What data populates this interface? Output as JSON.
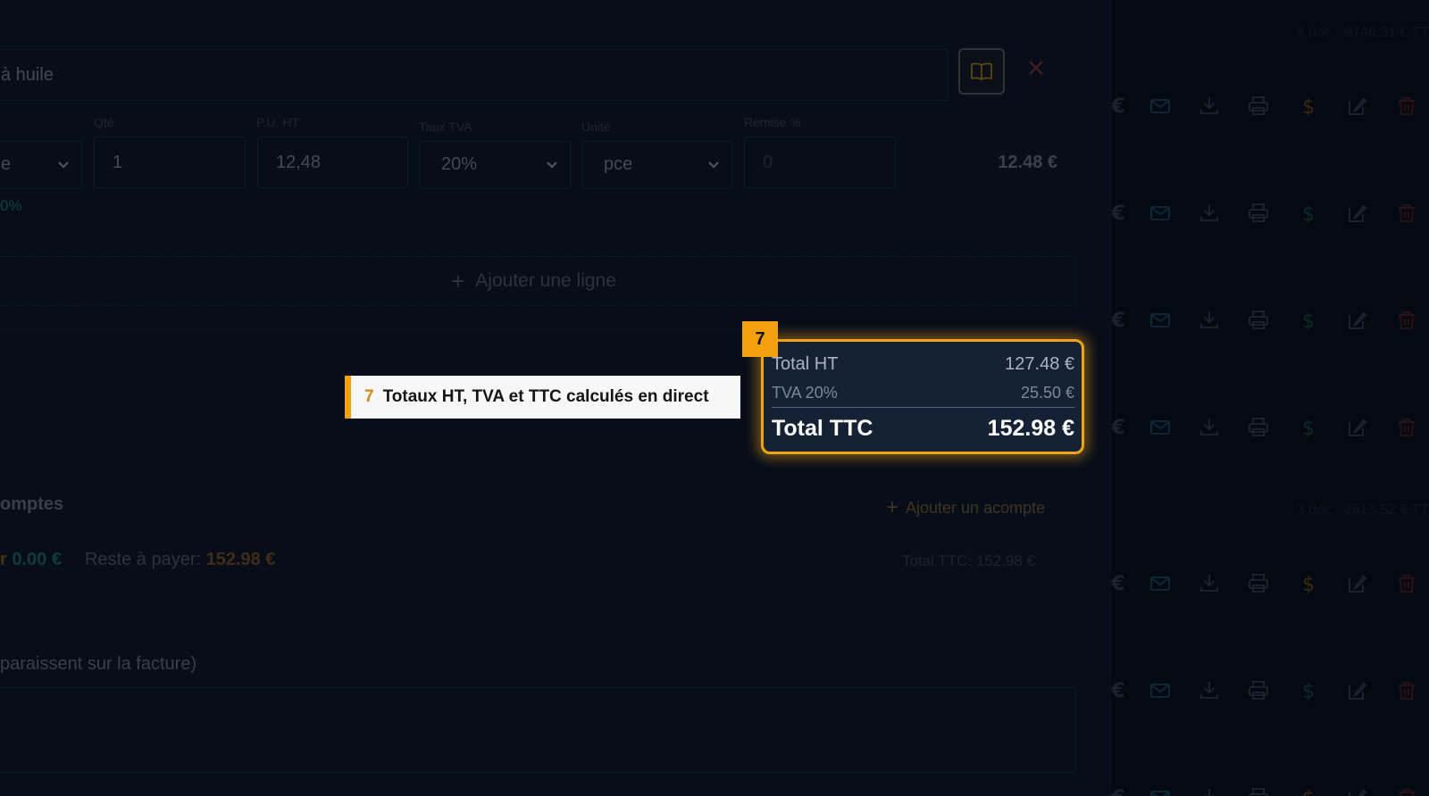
{
  "item": {
    "description_value": "à huile",
    "labels": {
      "qty": "Qté",
      "unit_price": "P.U. HT",
      "vat_rate": "Taux TVA",
      "unit": "Unité",
      "discount": "Remise %"
    },
    "type_select_partial": "e",
    "qty_value": "1",
    "unit_price_value": "12,48",
    "vat_rate_value": "20%",
    "unit_value": "pce",
    "discount_placeholder": "0",
    "line_total": "12.48 €",
    "margin_partial": "0%"
  },
  "add_line_label": "Ajouter une ligne",
  "totals": {
    "ht_label": "Total HT",
    "ht_value": "127.48 €",
    "tva_label": "TVA 20%",
    "tva_value": "25.50 €",
    "ttc_label": "Total TTC",
    "ttc_value": "152.98 €"
  },
  "tutorial": {
    "step_number": "7",
    "callout_text": "Totaux HT, TVA et TTC calculés en direct"
  },
  "deposits": {
    "section_title_partial": "omptes",
    "add_label": "Ajouter un acompte",
    "paid_value": "0.00 €",
    "paid_prefix_partial": "r",
    "rest_label": "Reste à payer:",
    "rest_value": "152.98 €",
    "total_ttc_text": "Total TTC: 152.98 €"
  },
  "notes": {
    "label_partial": "paraissent sur la facture)"
  },
  "right_panel": {
    "summary_1": "4 doc · 9746.31 € TT",
    "summary_2": "3 doc · 2513.52 € TT",
    "row_icon_names": [
      "euro-icon",
      "mail-icon",
      "download-icon",
      "print-icon",
      "dollar-icon",
      "edit-icon",
      "trash-icon"
    ],
    "dollar_colors": [
      "#7a4f16",
      "#14553f",
      "#14553f",
      "#14553f",
      "#7a4f16",
      "#14553f"
    ],
    "colors": {
      "mail": "#12506a",
      "neutral": "#3a4352",
      "trash": "#5a1e22"
    }
  },
  "colors": {
    "accent": "#f5a00f",
    "panel_bg": "#0d1626",
    "highlight_box": "#152235"
  }
}
